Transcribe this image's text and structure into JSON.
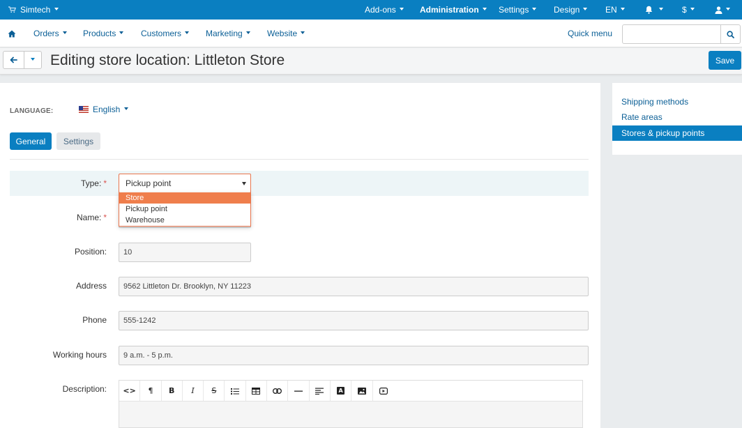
{
  "topbar": {
    "brand": "Simtech",
    "items": [
      {
        "label": "Add-ons"
      },
      {
        "label": "Administration"
      },
      {
        "label": "Settings"
      },
      {
        "label": "Design"
      },
      {
        "label": "EN"
      },
      {
        "label": "$"
      }
    ]
  },
  "nav": {
    "items": [
      "Orders",
      "Products",
      "Customers",
      "Marketing",
      "Website"
    ],
    "quick_menu": "Quick menu",
    "search_placeholder": ""
  },
  "header": {
    "title": "Editing store location: Littleton Store",
    "save_label": "Save"
  },
  "language": {
    "label": "LANGUAGE:",
    "value": "English"
  },
  "tabs": {
    "general": "General",
    "settings": "Settings"
  },
  "form": {
    "type": {
      "label": "Type:",
      "value": "Pickup point",
      "options": [
        "Store",
        "Pickup point",
        "Warehouse"
      ],
      "highlighted_option": "Store"
    },
    "name": {
      "label": "Name:",
      "value": ""
    },
    "position": {
      "label": "Position:",
      "value": "10"
    },
    "address": {
      "label": "Address",
      "value": "9562 Littleton Dr. Brooklyn, NY 11223"
    },
    "phone": {
      "label": "Phone",
      "value": "555-1242"
    },
    "working_hours": {
      "label": "Working hours",
      "value": "9 a.m. - 5 p.m."
    },
    "description": {
      "label": "Description:"
    },
    "required_mark": "*"
  },
  "editor_toolbar": {
    "buttons": [
      {
        "icon": "code-icon",
        "glyph": "<>"
      },
      {
        "icon": "paragraph-icon",
        "glyph": "¶"
      },
      {
        "icon": "bold-icon",
        "glyph": "B"
      },
      {
        "icon": "italic-icon",
        "glyph": "I"
      },
      {
        "icon": "strikethrough-icon",
        "glyph": "S"
      },
      {
        "icon": "unordered-list-icon",
        "glyph": ""
      },
      {
        "icon": "table-icon",
        "glyph": ""
      },
      {
        "icon": "link-icon",
        "glyph": ""
      },
      {
        "icon": "horizontal-rule-icon",
        "glyph": ""
      },
      {
        "icon": "align-icon",
        "glyph": ""
      },
      {
        "icon": "font-color-icon",
        "glyph": "A"
      },
      {
        "icon": "image-icon",
        "glyph": ""
      },
      {
        "icon": "video-icon",
        "glyph": ""
      }
    ]
  },
  "sidebar": {
    "items": [
      {
        "label": "Shipping methods"
      },
      {
        "label": "Rate areas"
      },
      {
        "label": "Stores & pickup points"
      }
    ],
    "active_item": "Stores & pickup points"
  },
  "colors": {
    "primary": "#0a7fc1",
    "link": "#0b5f96",
    "dropdown_highlight": "#ef7e4c",
    "required": "#d9534f"
  }
}
